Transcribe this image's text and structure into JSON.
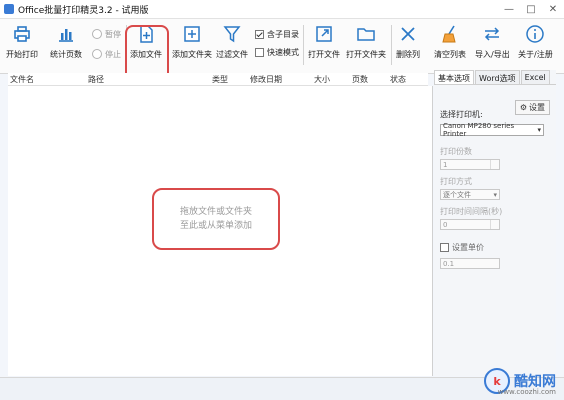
{
  "window": {
    "title": "Office批量打印精灵3.2 - 试用版",
    "controls": [
      "—",
      "□",
      "✕"
    ]
  },
  "toolbar": {
    "buttons": [
      {
        "id": "print",
        "label": "开始打印",
        "icon": "printer-icon"
      },
      {
        "id": "count",
        "label": "统计页数",
        "icon": "chart-icon"
      },
      {
        "id": "add_file",
        "label": "添加文件",
        "icon": "add-file-icon"
      },
      {
        "id": "add_folder",
        "label": "添加文件夹",
        "icon": "add-folder-icon"
      },
      {
        "id": "filter",
        "label": "过滤文件",
        "icon": "filter-icon"
      },
      {
        "id": "open_file",
        "label": "打开文件",
        "icon": "open-file-icon"
      },
      {
        "id": "open_folder",
        "label": "打开文件夹",
        "icon": "open-folder-icon"
      },
      {
        "id": "delete",
        "label": "删除列",
        "icon": "delete-icon"
      },
      {
        "id": "clear",
        "label": "清空列表",
        "icon": "broom-icon"
      },
      {
        "id": "import_export",
        "label": "导入/导出",
        "icon": "swap-icon"
      },
      {
        "id": "about",
        "label": "关于/注册",
        "icon": "info-icon"
      }
    ],
    "radios": [
      {
        "label": "暂停"
      },
      {
        "label": "停止"
      }
    ],
    "checks": [
      {
        "label": "含子目录",
        "checked": true
      },
      {
        "label": "快速模式",
        "checked": false
      }
    ]
  },
  "table": {
    "columns": [
      "文件名",
      "路径",
      "类型",
      "修改日期",
      "大小",
      "页数",
      "状态"
    ]
  },
  "drop_hint": {
    "line1": "拖放文件或文件夹",
    "line2": "至此或从菜单添加"
  },
  "panel": {
    "tabs": [
      "基本选项",
      "Word选项",
      "Excel"
    ],
    "printer_label": "选择打印机:",
    "settings_label": "设置",
    "printer_value": "Canon MP280 series Printer",
    "copies_label": "打印份数",
    "copies_value": "1",
    "mode_label": "打印方式",
    "mode_value": "逐个文件",
    "interval_label": "打印时间间隔(秒)",
    "interval_value": "0",
    "price_label": "设置单价",
    "price_value": "0.1"
  },
  "watermark": {
    "brand": "酷知网",
    "url": "www.coozhi.com"
  }
}
